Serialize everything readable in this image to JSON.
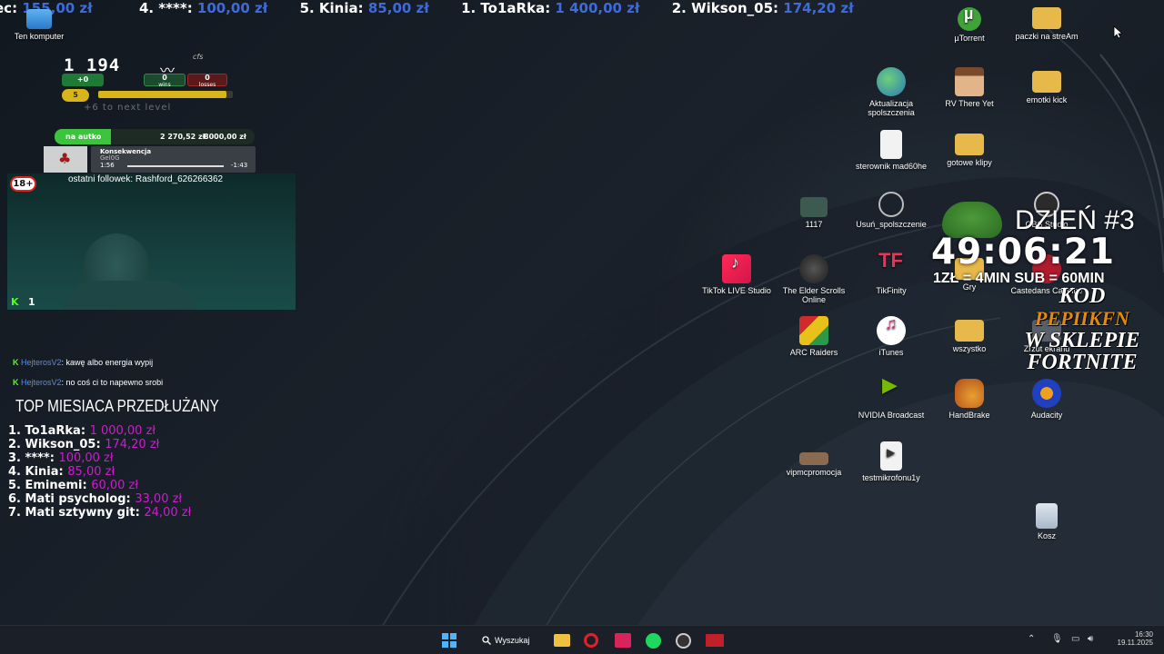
{
  "ticker": [
    {
      "name": "ec:",
      "amount": "155,00 zł"
    },
    {
      "name": "4. ****:",
      "amount": "100,00 zł"
    },
    {
      "name": "5. Kinia:",
      "amount": "85,00 zł"
    },
    {
      "name": "1. To1aRka:",
      "amount": "1 400,00 zł"
    },
    {
      "name": "2. Wikson_05:",
      "amount": "174,20 zł"
    }
  ],
  "desktop_icons": {
    "ten_komputer": "Ten komputer",
    "utorrent": "µTorrent",
    "paczki": "paczki na streAm",
    "aktualizacja": "Aktualizacja spolszczenia",
    "rv_there_yet": "RV There Yet",
    "emotki_kick": "emotki kick",
    "sterownik": "sterownik mad60he",
    "gotowe_klipy": "gotowe klipy",
    "i1117": "1117",
    "usun_spolszczenie": "Usuń_spolszczenie",
    "obs": "OBS Studio",
    "tiktok": "TikTok LIVE Studio",
    "elder_scrolls": "The Elder Scrolls Online",
    "tikfinity": "TikFinity",
    "gry": "Gry",
    "castedans": "Castedans Caffeine",
    "arc_raiders": "ARC Raiders",
    "itunes": "iTunes",
    "wszystko": "wszystko",
    "zrzut": "Zrzut ekranu",
    "nvidia": "NVIDIA Broadcast",
    "handbrake": "HandBrake",
    "audacity": "Audacity",
    "vipmc": "vipmcpromocja",
    "testmikrofonu": "testmikrofonu1y",
    "kosz": "Kosz"
  },
  "rank": {
    "score": "1 194",
    "tag": "cfs",
    "wins": "0",
    "wins_label": "wins",
    "losses": "0",
    "losses_label": "losses",
    "delta": "+0",
    "level": "5",
    "next_level": "+6 to next level",
    "xp_fraction": 0.95
  },
  "goal": {
    "label": "na autko",
    "current": "2 270,52 zł",
    "target": "8000,00 zł"
  },
  "song": {
    "title": "Konsekwencja",
    "artist": "Gel0G",
    "elapsed": "1:56",
    "remaining": "-1:43"
  },
  "webcam": {
    "age_badge": "18+",
    "last_follower": "ostatni followek: Rashford_626266362",
    "viewers": "1"
  },
  "chat": [
    {
      "user": "HejterosV2",
      "message": ": kawę albo energia wypij"
    },
    {
      "user": "HejterosV2",
      "message": ": no coś ci to napewno srobi"
    }
  ],
  "top_month": {
    "title": "TOP MIESIACA PRZEDŁUŻANY",
    "entries": [
      {
        "name": "1. To1aRka:",
        "amount": "1 000,00 zł"
      },
      {
        "name": "2. Wikson_05:",
        "amount": "174,20 zł"
      },
      {
        "name": "3. ****:",
        "amount": "100,00 zł"
      },
      {
        "name": "4. Kinia:",
        "amount": "85,00 zł"
      },
      {
        "name": "5. Eminemi:",
        "amount": "60,00 zł"
      },
      {
        "name": "6. Mati psycholog:",
        "amount": "33,00 zł"
      },
      {
        "name": "7. Mati sztywny git:",
        "amount": "24,00 zł"
      }
    ]
  },
  "subathon": {
    "day": "DZIEŃ #3",
    "timer": "49:06:21",
    "rates": "1ZŁ = 4MIN  SUB = 60MIN",
    "kod_line1": "KOD",
    "kod_line2": "PEPIIKFN",
    "kod_line3": "W SKLEPIE",
    "kod_line4": "FORTNITE"
  },
  "taskbar": {
    "search_label": "Wyszukaj",
    "time": "16:30",
    "date": "19.11.2025"
  },
  "colors": {
    "accent_blue": "#3e6bd8",
    "donation_magenta": "#d01ad0",
    "goal_green": "#3cc43e",
    "xp_gold": "#d8b51a"
  }
}
